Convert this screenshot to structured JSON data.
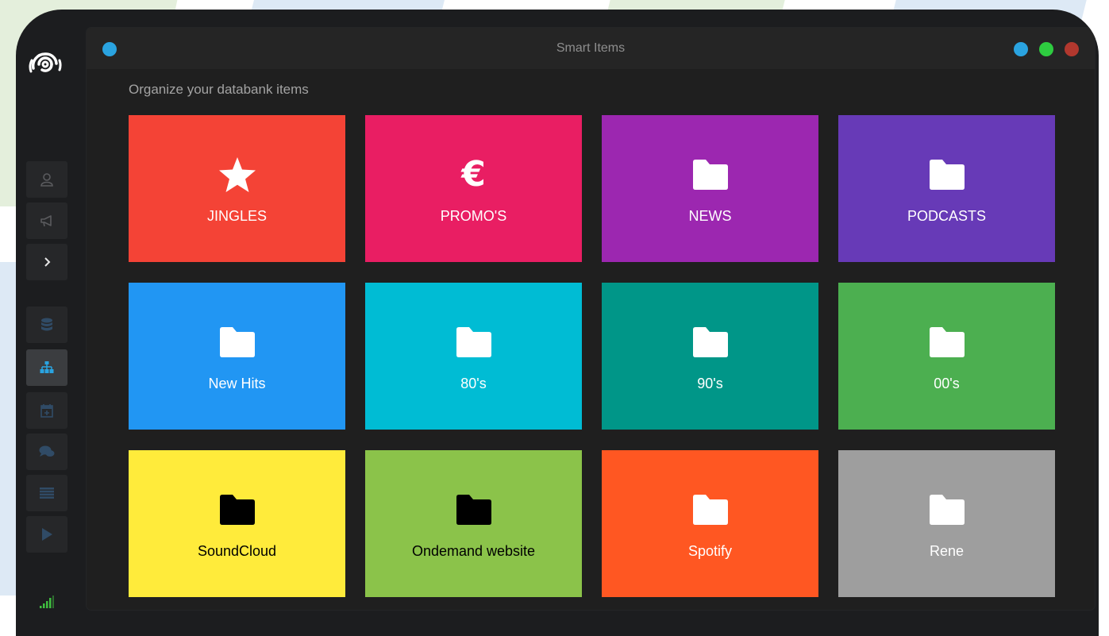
{
  "window": {
    "title": "Smart Items",
    "subtitle": "Organize your databank items"
  },
  "sidebar": {
    "items": [
      {
        "name": "user-icon",
        "active": false,
        "color": "#5a5b5e"
      },
      {
        "name": "megaphone-icon",
        "active": false,
        "color": "#5a5b5e"
      },
      {
        "name": "chevron-right-icon",
        "active": false,
        "color": "#e6e6e6"
      },
      {
        "name": "database-icon",
        "active": false,
        "color": "#304b66"
      },
      {
        "name": "sitemap-icon",
        "active": true,
        "color": "#2aa3e0"
      },
      {
        "name": "calendar-plus-icon",
        "active": false,
        "color": "#304b66"
      },
      {
        "name": "comments-icon",
        "active": false,
        "color": "#304b66"
      },
      {
        "name": "list-icon",
        "active": false,
        "color": "#304b66"
      },
      {
        "name": "play-icon",
        "active": false,
        "color": "#304b66"
      },
      {
        "name": "signal-icon",
        "active": false,
        "color": "#3fbf3f"
      }
    ]
  },
  "tiles": [
    {
      "label": "JINGLES",
      "color": "#f44336",
      "icon": "star-icon",
      "text_color": "#ffffff"
    },
    {
      "label": "PROMO'S",
      "color": "#e91e63",
      "icon": "euro-icon",
      "symbol": "€",
      "text_color": "#ffffff"
    },
    {
      "label": "NEWS",
      "color": "#9c27b0",
      "icon": "folder-icon",
      "text_color": "#ffffff"
    },
    {
      "label": "PODCASTS",
      "color": "#673ab7",
      "icon": "folder-icon",
      "text_color": "#ffffff"
    },
    {
      "label": "New Hits",
      "color": "#2196f3",
      "icon": "folder-icon",
      "text_color": "#ffffff"
    },
    {
      "label": "80's",
      "color": "#00bcd4",
      "icon": "folder-icon",
      "text_color": "#ffffff"
    },
    {
      "label": "90's",
      "color": "#009688",
      "icon": "folder-icon",
      "text_color": "#ffffff"
    },
    {
      "label": "00's",
      "color": "#4caf50",
      "icon": "folder-icon",
      "text_color": "#ffffff"
    },
    {
      "label": "SoundCloud",
      "color": "#ffeb3b",
      "icon": "folder-icon",
      "text_color": "#000000"
    },
    {
      "label": "Ondemand website",
      "color": "#8bc34a",
      "icon": "folder-icon",
      "text_color": "#000000"
    },
    {
      "label": "Spotify",
      "color": "#ff5722",
      "icon": "folder-icon",
      "text_color": "#ffffff"
    },
    {
      "label": "Rene",
      "color": "#9e9e9e",
      "icon": "folder-icon",
      "text_color": "#ffffff"
    }
  ],
  "window_controls": {
    "left_dot_color": "#2aa3e0",
    "right_dot_colors": [
      "#2aa3e0",
      "#2ecc40",
      "#b2382e"
    ]
  }
}
